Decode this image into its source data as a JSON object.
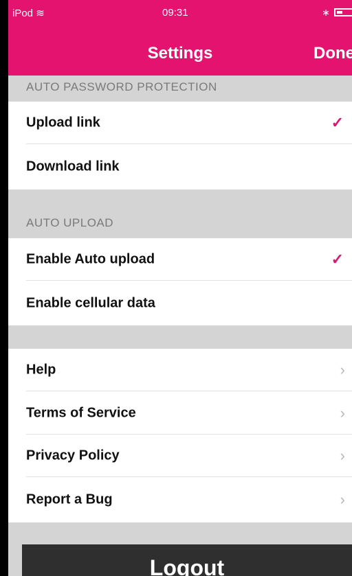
{
  "status_bar": {
    "carrier": "iPod",
    "wifi_icon": "wifi-icon",
    "time": "09:31",
    "bluetooth_icon": "bluetooth-icon"
  },
  "nav": {
    "title": "Settings",
    "done_label": "Done"
  },
  "sections": {
    "password": {
      "header": "AUTO PASSWORD PROTECTION",
      "items": [
        {
          "label": "Upload link",
          "checked": true
        },
        {
          "label": "Download link",
          "checked": false
        }
      ]
    },
    "upload": {
      "header": "AUTO UPLOAD",
      "items": [
        {
          "label": "Enable Auto upload",
          "checked": true
        },
        {
          "label": "Enable cellular data",
          "checked": false
        }
      ]
    },
    "info": {
      "items": [
        {
          "label": "Help"
        },
        {
          "label": "Terms of Service"
        },
        {
          "label": "Privacy Policy"
        },
        {
          "label": "Report a Bug"
        }
      ]
    }
  },
  "logout_label": "Logout",
  "colors": {
    "accent": "#e4136f",
    "logout_bg": "#2f2f2f",
    "group_bg": "#d4d4d4"
  },
  "glyphs": {
    "check": "✓",
    "chevron": "›"
  }
}
